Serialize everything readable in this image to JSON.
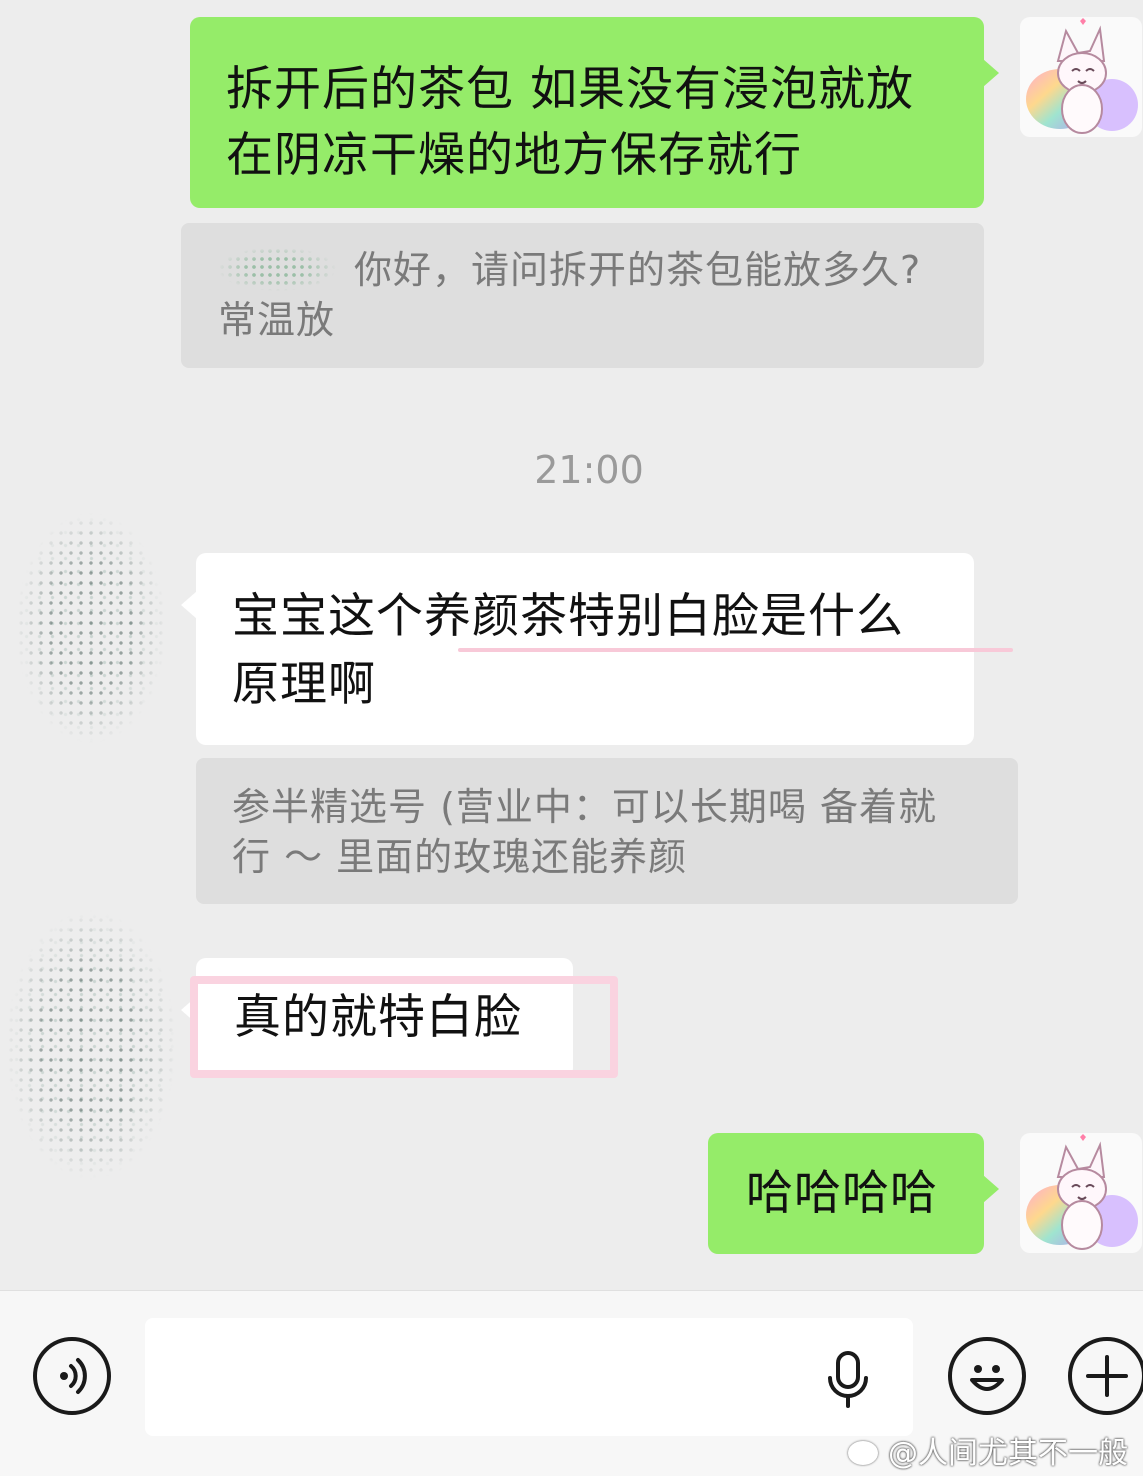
{
  "messages": {
    "m1_line1": "拆开后的茶包 如果没有浸泡就放",
    "m1_line2": "在阴凉干燥的地方保存就行",
    "q1_text": "你好，请问拆开的茶包能放多久?",
    "q1_text2": "常温放",
    "timestamp": "21:00",
    "m2_line1": "宝宝这个养颜茶特别白脸是什么",
    "m2_line2": "原理啊",
    "q2_line1": "参半精选号 (营业中：可以长期喝 备着就",
    "q2_line2": "行 ～ 里面的玫瑰还能养颜",
    "m3_text": "真的就特白脸",
    "m4_text": "哈哈哈哈"
  },
  "icons": {
    "self_avatar": "fox-avatar-icon",
    "contact_avatar": "blurred-avatar",
    "voice_toggle": "voice-toggle-icon",
    "mic": "mic-icon",
    "emoji": "emoji-icon",
    "plus": "plus-icon"
  },
  "colors": {
    "sent_bubble": "#95ec69",
    "received_bubble": "#ffffff",
    "background": "#ededed",
    "quote_box": "#dedede",
    "annotation_pink": "#f8c9d8"
  },
  "watermark": "@人间尤其不一般"
}
